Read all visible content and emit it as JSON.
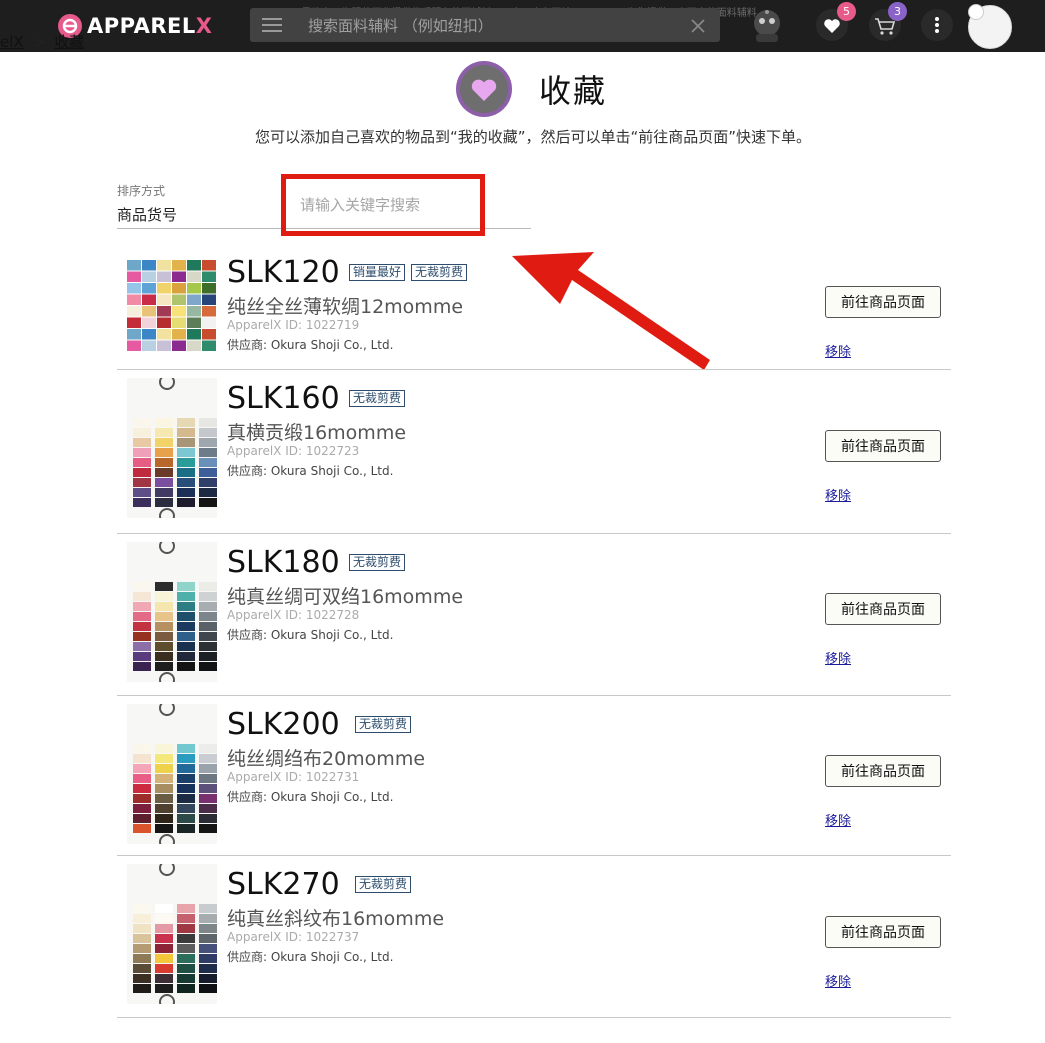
{
  "header": {
    "tagline": "ApparelX是致力于为服装行业提供优质服务的面辅料B2B电子商务网站。ApparelX为您提供日本国内的面料辅料",
    "logo_text_main": "APPAREL",
    "logo_text_x": "X",
    "search_placeholder": "搜索面料辅料 （例如纽扣）",
    "favorites_count": "5",
    "cart_count": "3",
    "colors": {
      "bar": "#1e1e1e",
      "fav_badge": "#e85a8a",
      "cart_badge": "#8a63c9"
    }
  },
  "breadcrumb": {
    "home": "elX",
    "separator": ">",
    "current": "收藏"
  },
  "page": {
    "title": "收藏",
    "subtitle": "您可以添加自己喜欢的物品到“我的收藏”，然后可以单击“前往商品页面”快速下单。",
    "sort_label": "排序方式",
    "sort_value": "商品货号",
    "keyword_placeholder": "请输入关键字搜索"
  },
  "items": [
    {
      "code": "SLK120",
      "tags": [
        "销量最好",
        "无裁剪费"
      ],
      "name": "纯丝全丝薄软绸12momme",
      "id": "ApparelX ID: 1022719",
      "supplier": "供应商: Okura Shoji Co., Ltd.",
      "button": "前往商品页面",
      "remove": "移除"
    },
    {
      "code": "SLK160",
      "tags": [
        "无裁剪费"
      ],
      "name": "真横贡缎16momme",
      "id": "ApparelX ID: 1022723",
      "supplier": "供应商: Okura Shoji Co., Ltd.",
      "button": "前往商品页面",
      "remove": "移除"
    },
    {
      "code": "SLK180",
      "tags": [
        "无裁剪费"
      ],
      "name": "纯真丝绸可双绉16momme",
      "id": "ApparelX ID: 1022728",
      "supplier": "供应商: Okura Shoji Co., Ltd.",
      "button": "前往商品页面",
      "remove": "移除"
    },
    {
      "code": "SLK200",
      "tags": [
        "无裁剪费"
      ],
      "name": "纯丝绸绉布20momme",
      "id": "ApparelX ID: 1022731",
      "supplier": "供应商: Okura Shoji Co., Ltd.",
      "button": "前往商品页面",
      "remove": "移除"
    },
    {
      "code": "SLK270",
      "tags": [
        "无裁剪费"
      ],
      "name": "纯真丝斜纹布16momme",
      "id": "ApparelX ID: 1022737",
      "supplier": "供应商: Okura Shoji Co., Ltd.",
      "button": "前往商品页面",
      "remove": "移除"
    }
  ],
  "annotation": {
    "color": "#e01c12"
  }
}
